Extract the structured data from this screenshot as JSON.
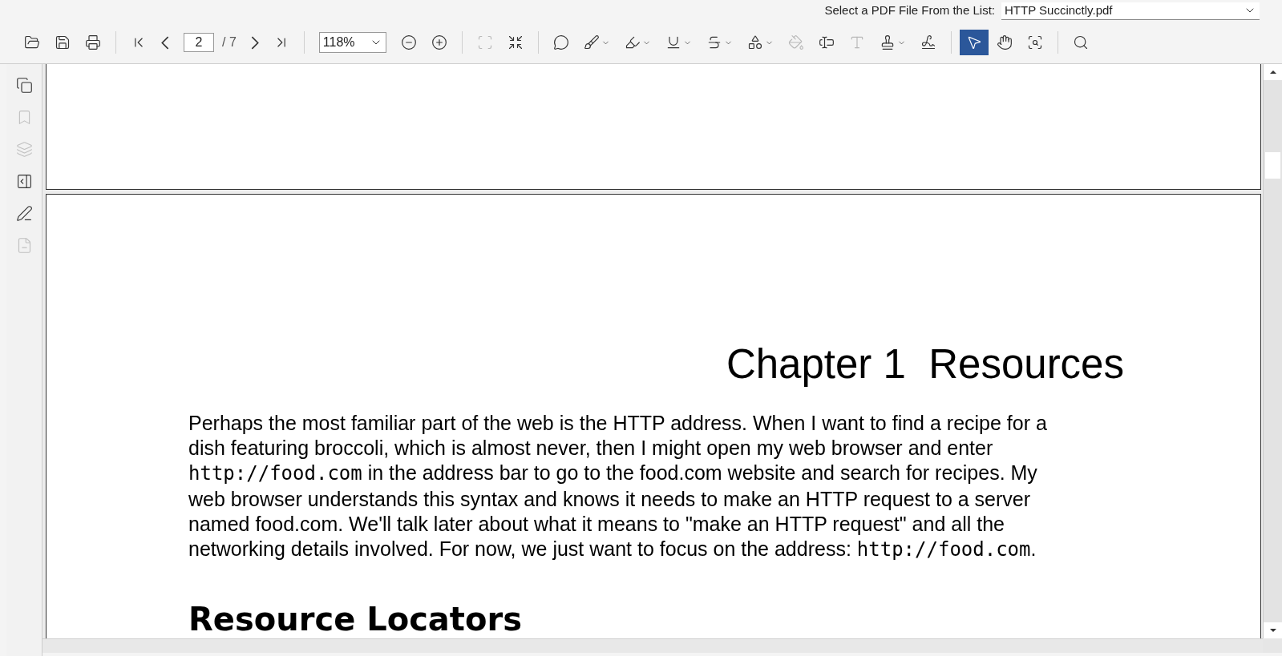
{
  "file_picker": {
    "label": "Select a PDF File From the List:",
    "value": "HTTP Succinctly.pdf"
  },
  "toolbar": {
    "file_tools": [
      {
        "disabled": false
      },
      {
        "disabled": false
      },
      {
        "disabled": false
      }
    ],
    "page_field": {
      "value": "2",
      "total": "/ 7"
    },
    "zoom": {
      "value": "118%"
    },
    "view_tools": [
      {
        "disabled": true
      },
      {
        "disabled": false
      }
    ],
    "annotation_tools": [
      {
        "disabled": false
      },
      {
        "disabled": false
      },
      {
        "disabled": false
      },
      {
        "disabled": false
      },
      {
        "disabled": false
      },
      {
        "disabled": false
      },
      {
        "disabled": true
      },
      {
        "disabled": false
      },
      {
        "disabled": true
      },
      {
        "disabled": false
      },
      {
        "disabled": false
      }
    ],
    "interaction_tools": [
      {
        "selected": true
      },
      {
        "selected": false
      },
      {
        "selected": false
      }
    ]
  },
  "sidebar": [
    {
      "disabled": false
    },
    {
      "disabled": true
    },
    {
      "disabled": true
    },
    {
      "disabled": false
    },
    {
      "disabled": false
    },
    {
      "disabled": true
    }
  ],
  "document": {
    "chapter_title": "Chapter 1  Resources",
    "paragraph": [
      {
        "kind": "text",
        "text": "Perhaps the most familiar part of the web is the HTTP address. When I want to find a recipe for a dish featuring broccoli, which is almost never, then I might open my web browser and enter "
      },
      {
        "kind": "code",
        "text": "http://food.com"
      },
      {
        "kind": "text",
        "text": " in the address bar to go to the food.com website and search for recipes. My web browser understands this syntax and knows it needs to make an HTTP request to a server named food.com. We'll talk later about what it means to \"make an HTTP request\" and all the networking details involved. For now, we just want to focus on the address: "
      },
      {
        "kind": "code",
        "text": "http://food.com"
      },
      {
        "kind": "text",
        "text": "."
      }
    ],
    "section_heading": "Resource Locators"
  }
}
